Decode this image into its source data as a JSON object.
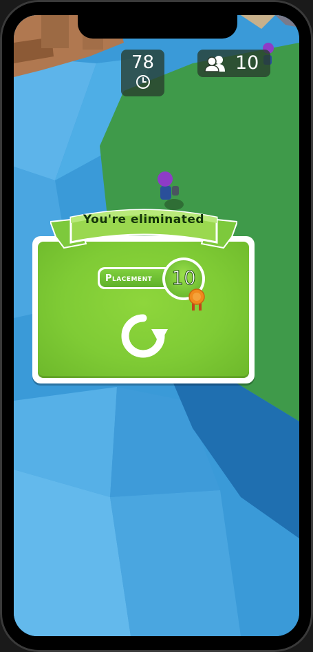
{
  "hud": {
    "timer_value": "78",
    "timer_icon": "clock-icon",
    "players_value": "10",
    "players_icon": "players-icon"
  },
  "result_panel": {
    "banner_text": "You're eliminated",
    "placement_label": "Placement",
    "placement_value": "10",
    "medal_icon": "medal-icon",
    "restart_icon": "restart-icon"
  },
  "colors": {
    "water": "#2f8fd0",
    "grass": "#3f9a4a",
    "panel_green": "#7fcb35",
    "hud_bg": "#2c3c2d"
  }
}
